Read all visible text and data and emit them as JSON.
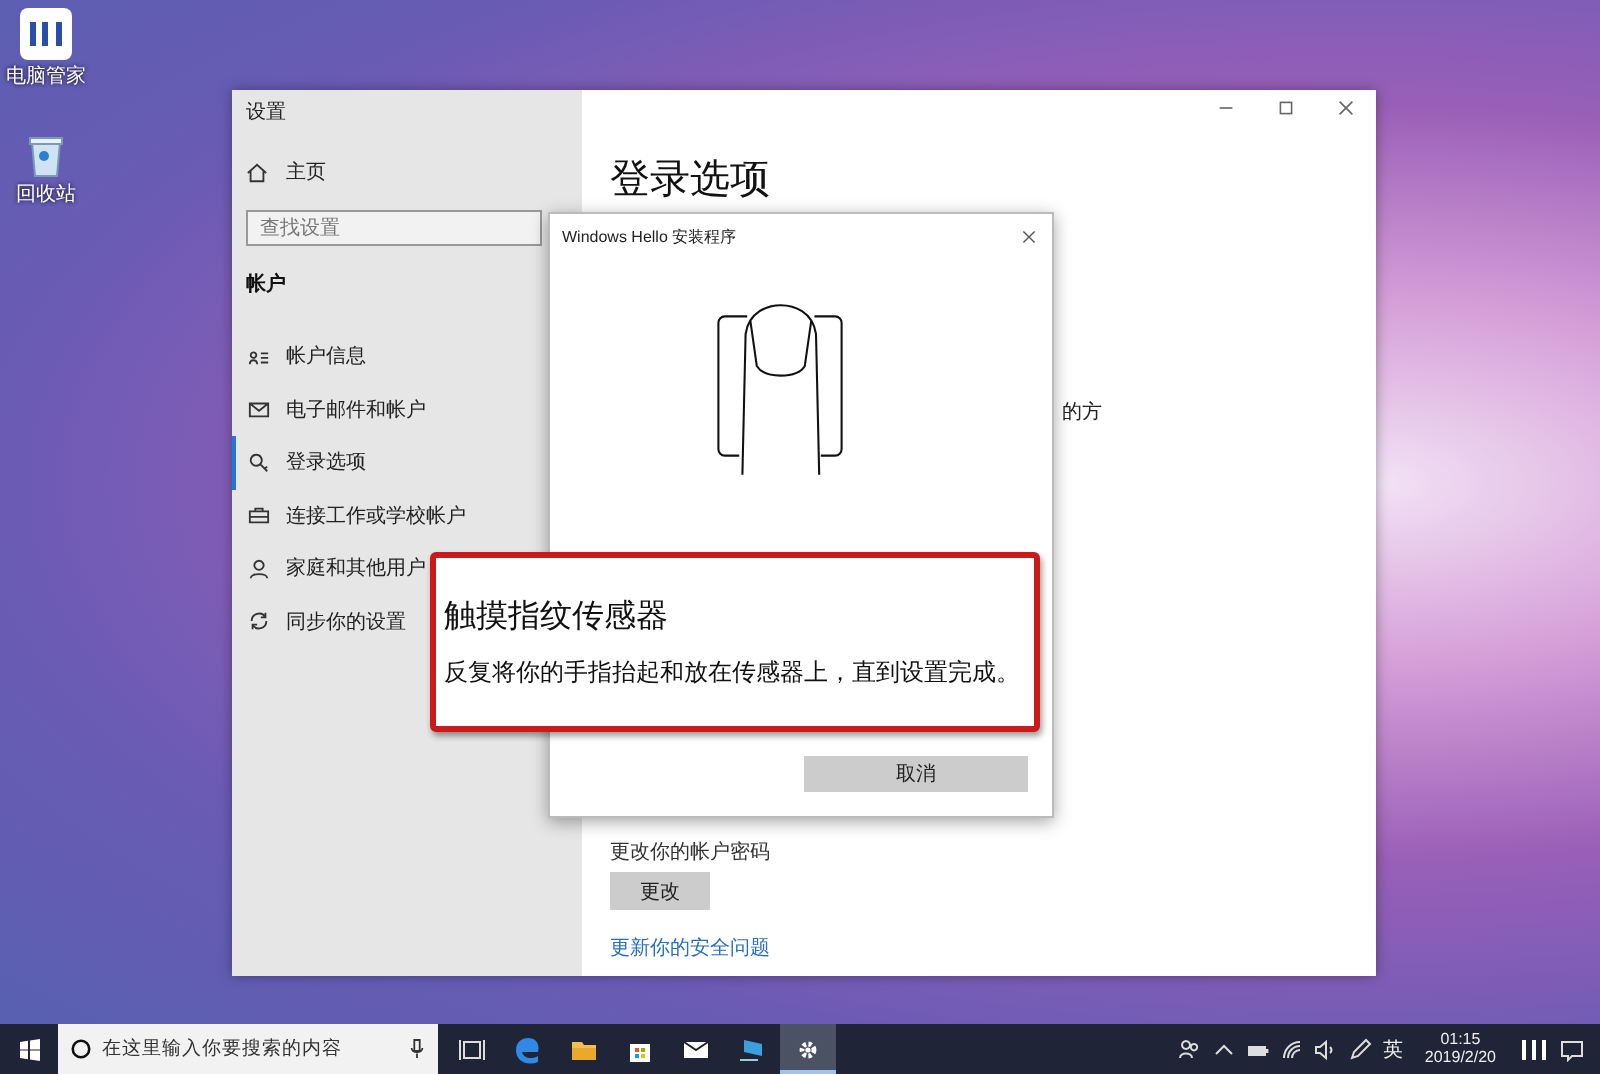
{
  "desktop_icons": [
    {
      "label": "电脑管家"
    },
    {
      "label": "回收站"
    }
  ],
  "settings": {
    "window_title": "设置",
    "home": "主页",
    "search_placeholder": "查找设置",
    "section": "帐户",
    "nav": [
      {
        "label": "帐户信息",
        "selected": false
      },
      {
        "label": "电子邮件和帐户",
        "selected": false
      },
      {
        "label": "登录选项",
        "selected": true
      },
      {
        "label": "连接工作或学校帐户",
        "selected": false
      },
      {
        "label": "家庭和其他用户",
        "selected": false
      },
      {
        "label": "同步你的设置",
        "selected": false
      }
    ],
    "page_title": "登录选项",
    "fragment": "的方",
    "password_hint": "更改你的帐户密码",
    "change_button": "更改",
    "security_link": "更新你的安全问题"
  },
  "dialog": {
    "title": "Windows Hello 安装程序",
    "cancel_button": "取消"
  },
  "callout": {
    "heading": "触摸指纹传感器",
    "body": "反复将你的手指抬起和放在传感器上，直到设置完成。"
  },
  "taskbar": {
    "search_placeholder": "在这里输入你要搜索的内容",
    "apps": [
      {
        "selected": false
      },
      {
        "selected": false
      },
      {
        "selected": false
      },
      {
        "selected": false
      },
      {
        "selected": false
      },
      {
        "selected": false
      },
      {
        "selected": true
      }
    ],
    "language": "英",
    "time": "01:15",
    "date": "2019/2/20"
  }
}
